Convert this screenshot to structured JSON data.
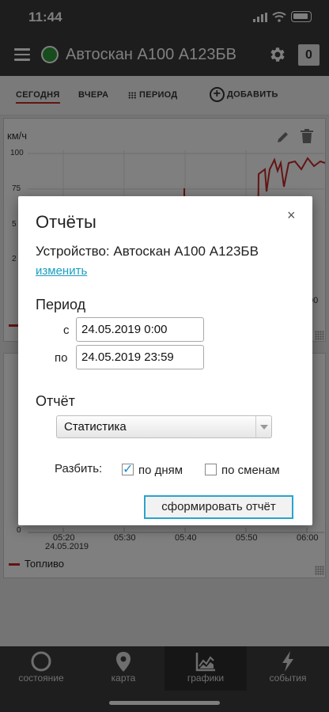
{
  "status": {
    "time": "11:44"
  },
  "header": {
    "title": "Автоскан А100 А123БВ",
    "counter": "0",
    "status_color": "#2e9a3a"
  },
  "tabs": [
    {
      "label": "СЕГОДНЯ"
    },
    {
      "label": "ВЧЕРА"
    },
    {
      "label": "ПЕРИОД"
    },
    {
      "label": "ДОБАВИТЬ"
    }
  ],
  "chart_top": {
    "unit": "км/ч",
    "y_ticks": [
      "100",
      "75",
      "5",
      "2"
    ],
    "x_tick_partial": "00"
  },
  "chart_bottom": {
    "y_zero": "0",
    "x_ticks": [
      "05:20",
      "05:30",
      "05:40",
      "05:50",
      "06:00"
    ],
    "date": "24.05.2019",
    "legend": "Топливо"
  },
  "dialog": {
    "title": "Отчёты",
    "close": "×",
    "device": "Устройство: Автоскан А100 А123БВ",
    "change_link": "изменить",
    "period_heading": "Период",
    "from_label": "с",
    "from_value": "24.05.2019 0:00",
    "to_label": "по",
    "to_value": "24.05.2019 23:59",
    "report_heading": "Отчёт",
    "report_selected": "Статистика",
    "split_label": "Разбить:",
    "by_days": "по дням",
    "by_days_checked": true,
    "by_shifts": "по сменам",
    "by_shifts_checked": false,
    "submit": "сформировать отчёт"
  },
  "bottom_nav": [
    {
      "label": "состояние",
      "icon": "state-icon"
    },
    {
      "label": "карта",
      "icon": "map-pin-icon"
    },
    {
      "label": "графики",
      "icon": "charts-icon"
    },
    {
      "label": "события",
      "icon": "events-icon"
    }
  ],
  "colors": {
    "accent": "#c62828",
    "link": "#1a9fbf",
    "topbar": "#3a3a3a"
  }
}
